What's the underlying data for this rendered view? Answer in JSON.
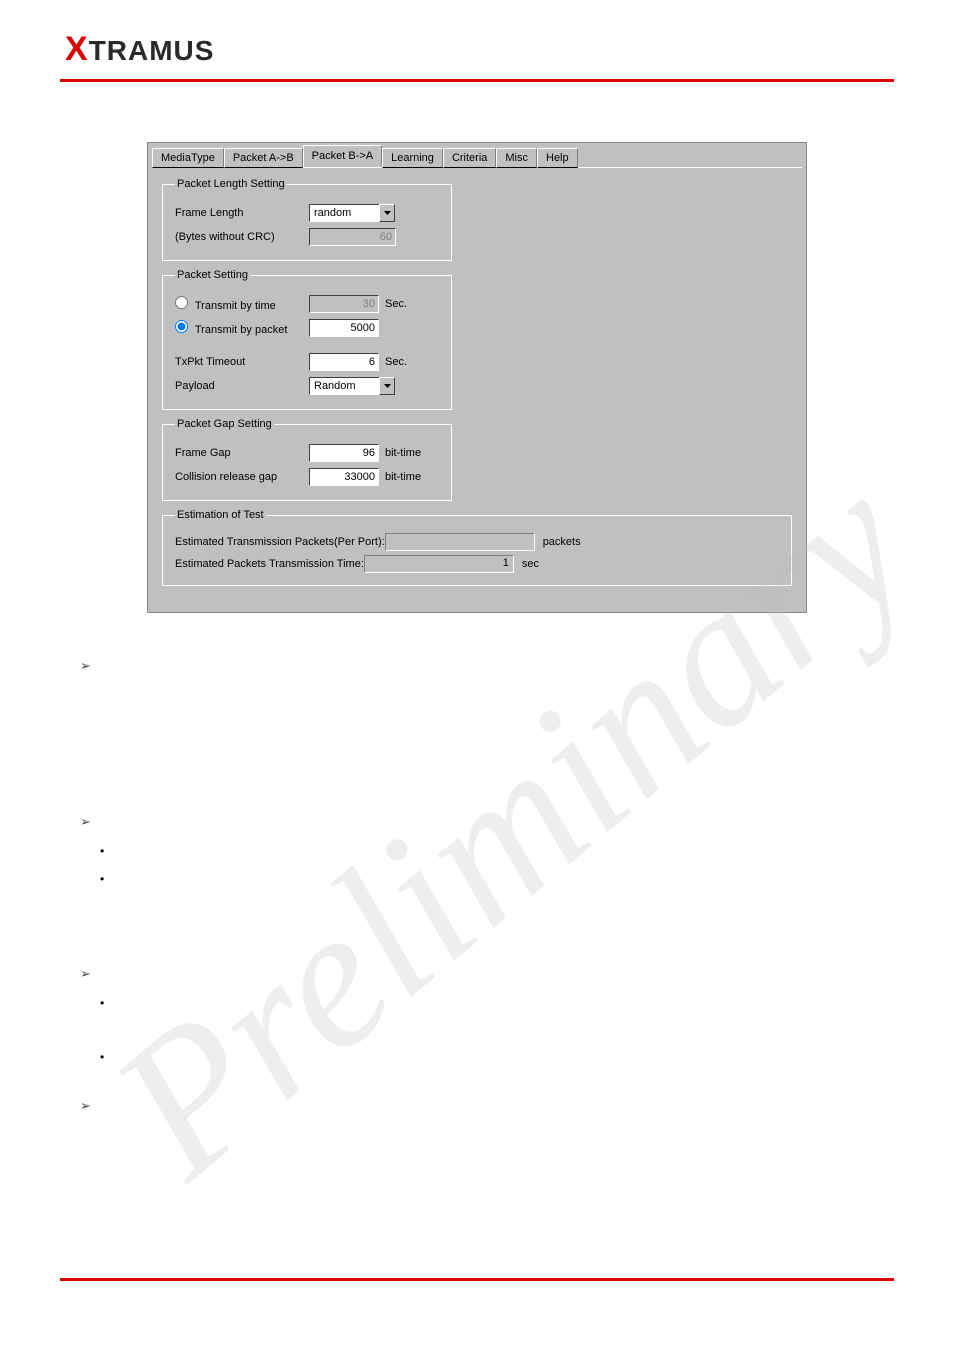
{
  "brand": "TRAMUS",
  "tabs": {
    "mediaType": "MediaType",
    "packetAB": "Packet A->B",
    "packetBA": "Packet B->A",
    "learning": "Learning",
    "criteria": "Criteria",
    "misc": "Misc",
    "help": "Help"
  },
  "packetLengthSetting": {
    "legend": "Packet Length Setting",
    "frameLengthLabel": "Frame Length",
    "frameLengthValue": "random",
    "bytesNoCRCLabel": "(Bytes without CRC)",
    "bytesNoCRCValue": "60"
  },
  "packetSetting": {
    "legend": "Packet Setting",
    "transmitByTimeLabel": "Transmit by time",
    "transmitByTimeValue": "30",
    "transmitByTimeUnit": "Sec.",
    "transmitByPacketLabel": "Transmit by packet",
    "transmitByPacketValue": "5000",
    "txPktTimeoutLabel": "TxPkt Timeout",
    "txPktTimeoutValue": "6",
    "txPktTimeoutUnit": "Sec.",
    "payloadLabel": "Payload",
    "payloadValue": "Random"
  },
  "packetGapSetting": {
    "legend": "Packet Gap Setting",
    "frameGapLabel": "Frame Gap",
    "frameGapValue": "96",
    "frameGapUnit": "bit-time",
    "collisionLabel": "Collision release gap",
    "collisionValue": "33000",
    "collisionUnit": "bit-time"
  },
  "estimation": {
    "legend": "Estimation of Test",
    "estTxPacketsLabel": "Estimated Transmission Packets(Per Port):",
    "estTxPacketsValue": "",
    "estTxPacketsUnit": "packets",
    "estTimeLabel": "Estimated Packets Transmission Time:",
    "estTimeValue": "1",
    "estTimeUnit": "sec"
  }
}
